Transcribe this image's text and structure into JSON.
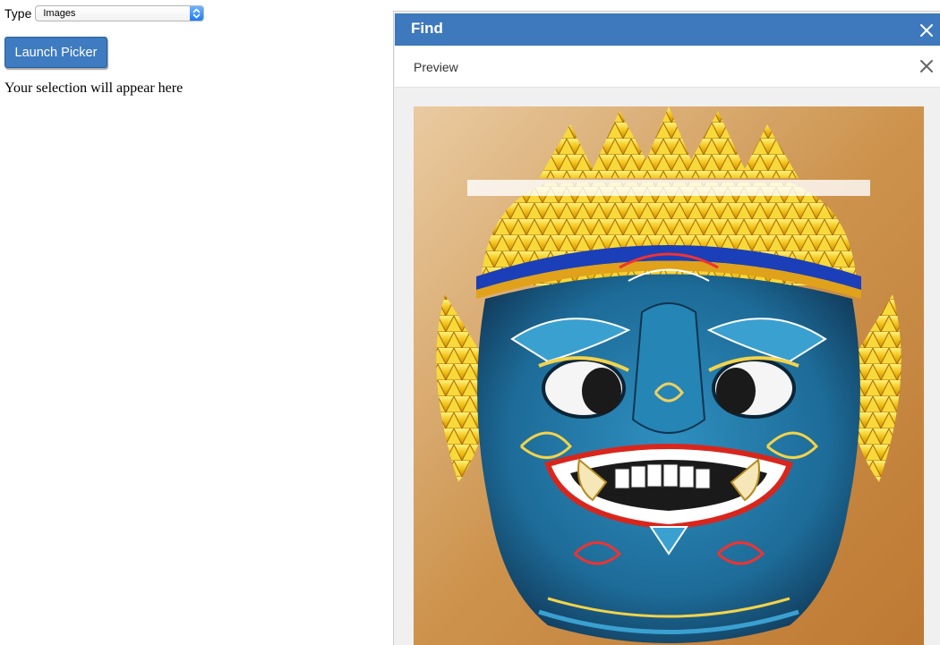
{
  "form": {
    "type_label": "Type",
    "type_select_value": "Images",
    "launch_button_label": "Launch Picker",
    "selection_placeholder": "Your selection will appear here"
  },
  "picker": {
    "title": "Find",
    "preview_label": "Preview",
    "preview_image_alt": "Preview image",
    "header_color": "#3e78bd"
  },
  "icons": {
    "select_arrow": "up-down-chevron-icon",
    "header_close": "close-icon",
    "preview_close": "close-icon"
  }
}
